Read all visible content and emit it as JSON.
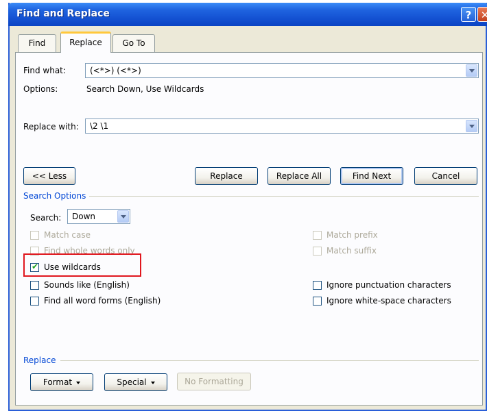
{
  "window": {
    "title": "Find and Replace",
    "help": "?",
    "close": "✕"
  },
  "tabs": [
    {
      "label": "Find"
    },
    {
      "label": "Replace"
    },
    {
      "label": "Go To"
    }
  ],
  "find": {
    "label": "Find what:",
    "value": "(<*>) (<*>)"
  },
  "options": {
    "label": "Options:",
    "value": "Search Down, Use Wildcards"
  },
  "replace": {
    "label": "Replace with:",
    "value": "\\2 \\1"
  },
  "buttons": {
    "less": "<< Less",
    "replace": "Replace",
    "replace_all": "Replace All",
    "find_next": "Find Next",
    "cancel": "Cancel"
  },
  "search_options": {
    "title": "Search Options",
    "search_label": "Search:",
    "search_value": "Down",
    "match_case": "Match case",
    "whole_words": "Find whole words only",
    "use_wildcards": "Use wildcards",
    "sounds_like": "Sounds like (English)",
    "word_forms": "Find all word forms (English)",
    "match_prefix": "Match prefix",
    "match_suffix": "Match suffix",
    "ignore_punct": "Ignore punctuation characters",
    "ignore_space": "Ignore white-space characters"
  },
  "replace_group": {
    "title": "Replace",
    "format": "Format",
    "special": "Special",
    "no_formatting": "No Formatting"
  },
  "colors": {
    "titlebar": "#0b44c3",
    "highlight": "#e0161d",
    "group_label": "#0046d5"
  }
}
